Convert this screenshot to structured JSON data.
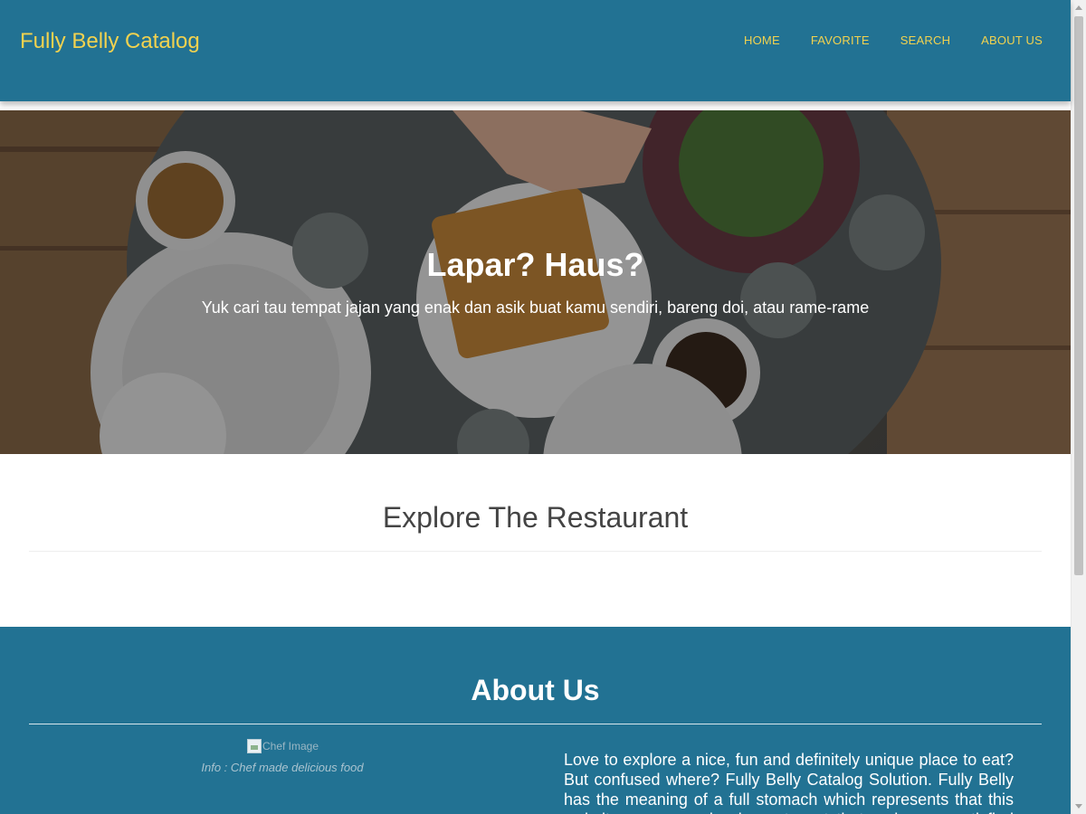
{
  "header": {
    "brand": "Fully Belly Catalog",
    "nav": [
      "HOME",
      "FAVORITE",
      "SEARCH",
      "ABOUT US"
    ]
  },
  "hero": {
    "title": "Lapar? Haus?",
    "subtitle": "Yuk cari tau tempat jajan yang enak dan asik buat kamu sendiri, bareng doi, atau rame-rame"
  },
  "explore": {
    "title": "Explore The Restaurant"
  },
  "about": {
    "title": "About Us",
    "image_alt": "Chef Image",
    "caption": "Info : Chef made delicious food",
    "text": "Love to explore a nice, fun and definitely unique place to eat? But confused where? Fully Belly Catalog Solution. Fully Belly has the meaning of a full stomach which represents that this website recommends places to eat that make you satisfied to..."
  },
  "colors": {
    "primary": "#227293",
    "accent": "#f2d24f"
  }
}
